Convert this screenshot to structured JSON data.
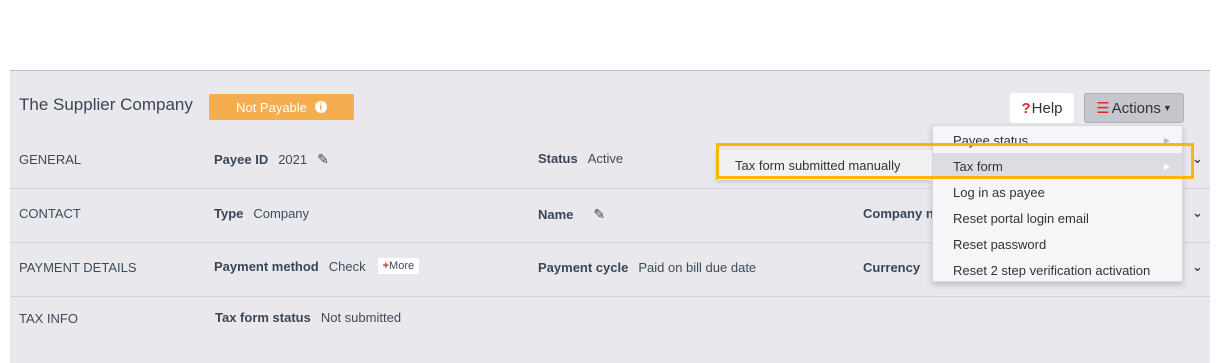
{
  "header": {
    "company_name": "The Supplier Company",
    "status_badge": "Not Payable",
    "help_label": "Help",
    "actions_label": "Actions"
  },
  "rows": {
    "general": {
      "label": "GENERAL",
      "payee_id_label": "Payee ID",
      "payee_id_value": "2021",
      "status_label": "Status",
      "status_value": "Active"
    },
    "contact": {
      "label": "CONTACT",
      "type_label": "Type",
      "type_value": "Company",
      "name_label": "Name",
      "company_label": "Company n"
    },
    "payment": {
      "label": "PAYMENT DETAILS",
      "method_label": "Payment method",
      "method_value": "Check",
      "more_label": "More",
      "cycle_label": "Payment cycle",
      "cycle_value": "Paid on bill due date",
      "currency_label": "Currency"
    },
    "tax": {
      "label": "TAX INFO",
      "form_status_label": "Tax form status",
      "form_status_value": "Not submitted"
    }
  },
  "actions_menu": {
    "items": [
      "Payee status",
      "Tax form",
      "Log in as payee",
      "Reset portal login email",
      "Reset password",
      "Reset 2 step verification activation"
    ],
    "submenu_item": "Tax form submitted manually"
  },
  "colors": {
    "badge": "#f4ae4f",
    "highlight": "#f6b800",
    "accent_red": "#e0262b"
  }
}
